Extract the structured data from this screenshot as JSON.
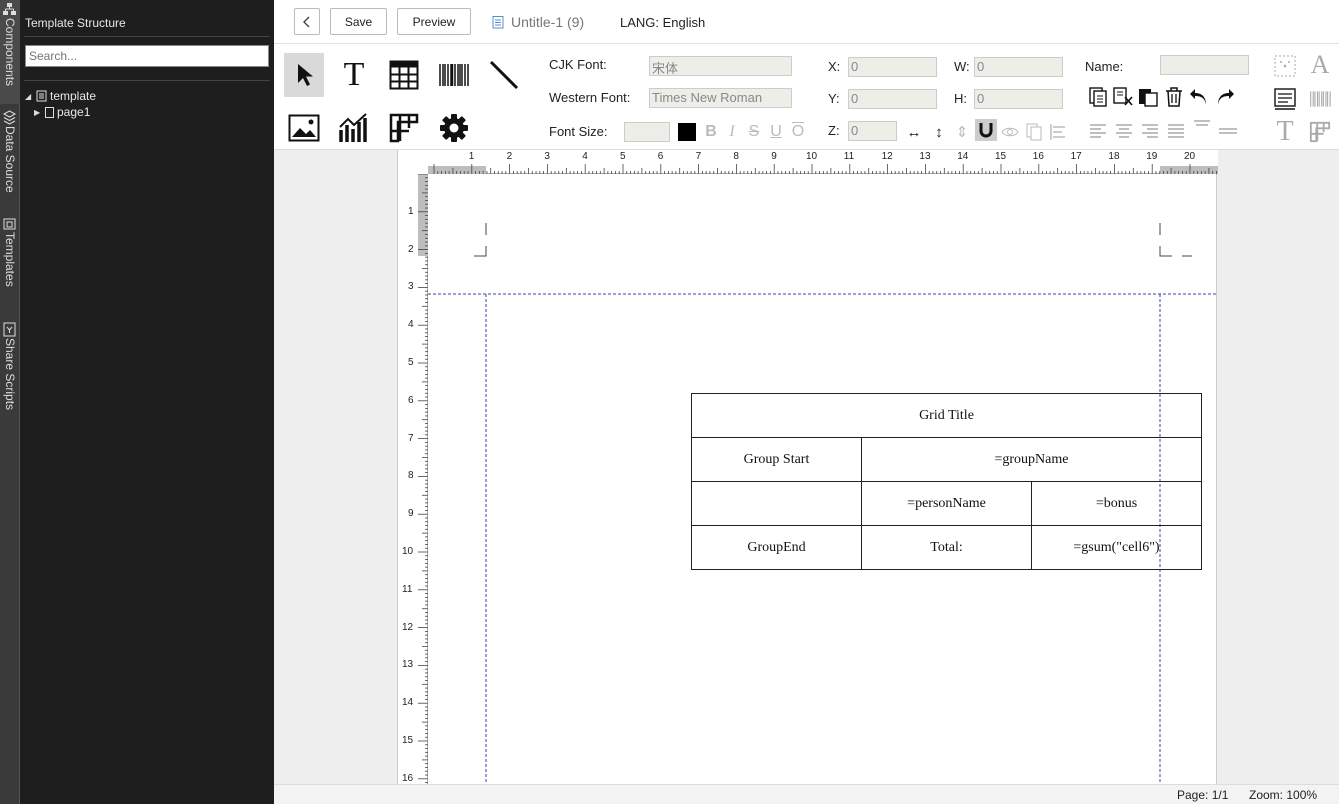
{
  "vtabs": [
    {
      "label": "Components",
      "icon": "components-icon"
    },
    {
      "label": "Data Source",
      "icon": "data-source-icon"
    },
    {
      "label": "Templates",
      "icon": "templates-icon"
    },
    {
      "label": "Share Scripts",
      "icon": "share-scripts-icon"
    }
  ],
  "sidebar": {
    "title": "Template Structure",
    "search_placeholder": "Search...",
    "tree": [
      {
        "label": "template",
        "expanded": true
      },
      {
        "label": "page1",
        "expanded": false
      }
    ]
  },
  "header": {
    "save_label": "Save",
    "preview_label": "Preview",
    "doc_title": "Untitle-1 (9)",
    "lang_label": "LANG: English"
  },
  "props": {
    "cjk_font_label": "CJK Font:",
    "cjk_font_value": "宋体",
    "western_font_label": "Western Font:",
    "western_font_value": "Times New Roman",
    "font_size_label": "Font Size:",
    "font_size_value": "",
    "x_label": "X:",
    "x_value": "0",
    "y_label": "Y:",
    "y_value": "0",
    "z_label": "Z:",
    "z_value": "0",
    "w_label": "W:",
    "w_value": "0",
    "h_label": "H:",
    "h_value": "0",
    "name_label": "Name:",
    "name_value": ""
  },
  "ruler": {
    "h": [
      "1",
      "2",
      "3",
      "4",
      "5",
      "6",
      "7",
      "8",
      "9",
      "10",
      "11",
      "12",
      "13",
      "14",
      "15",
      "16",
      "17",
      "18",
      "19",
      "20"
    ],
    "v": [
      "1",
      "2",
      "3",
      "4",
      "5",
      "6",
      "7",
      "8",
      "9",
      "10",
      "11",
      "12",
      "13",
      "14",
      "15",
      "16"
    ]
  },
  "grid": {
    "title": "Grid Title",
    "group_start": "Group Start",
    "group_name": "=groupName",
    "person_name": "=personName",
    "bonus": "=bonus",
    "group_end": "GroupEnd",
    "total": "Total:",
    "gsum": "=gsum(\"cell6\")"
  },
  "status": {
    "page": "Page: 1/1",
    "zoom": "Zoom: 100%"
  }
}
